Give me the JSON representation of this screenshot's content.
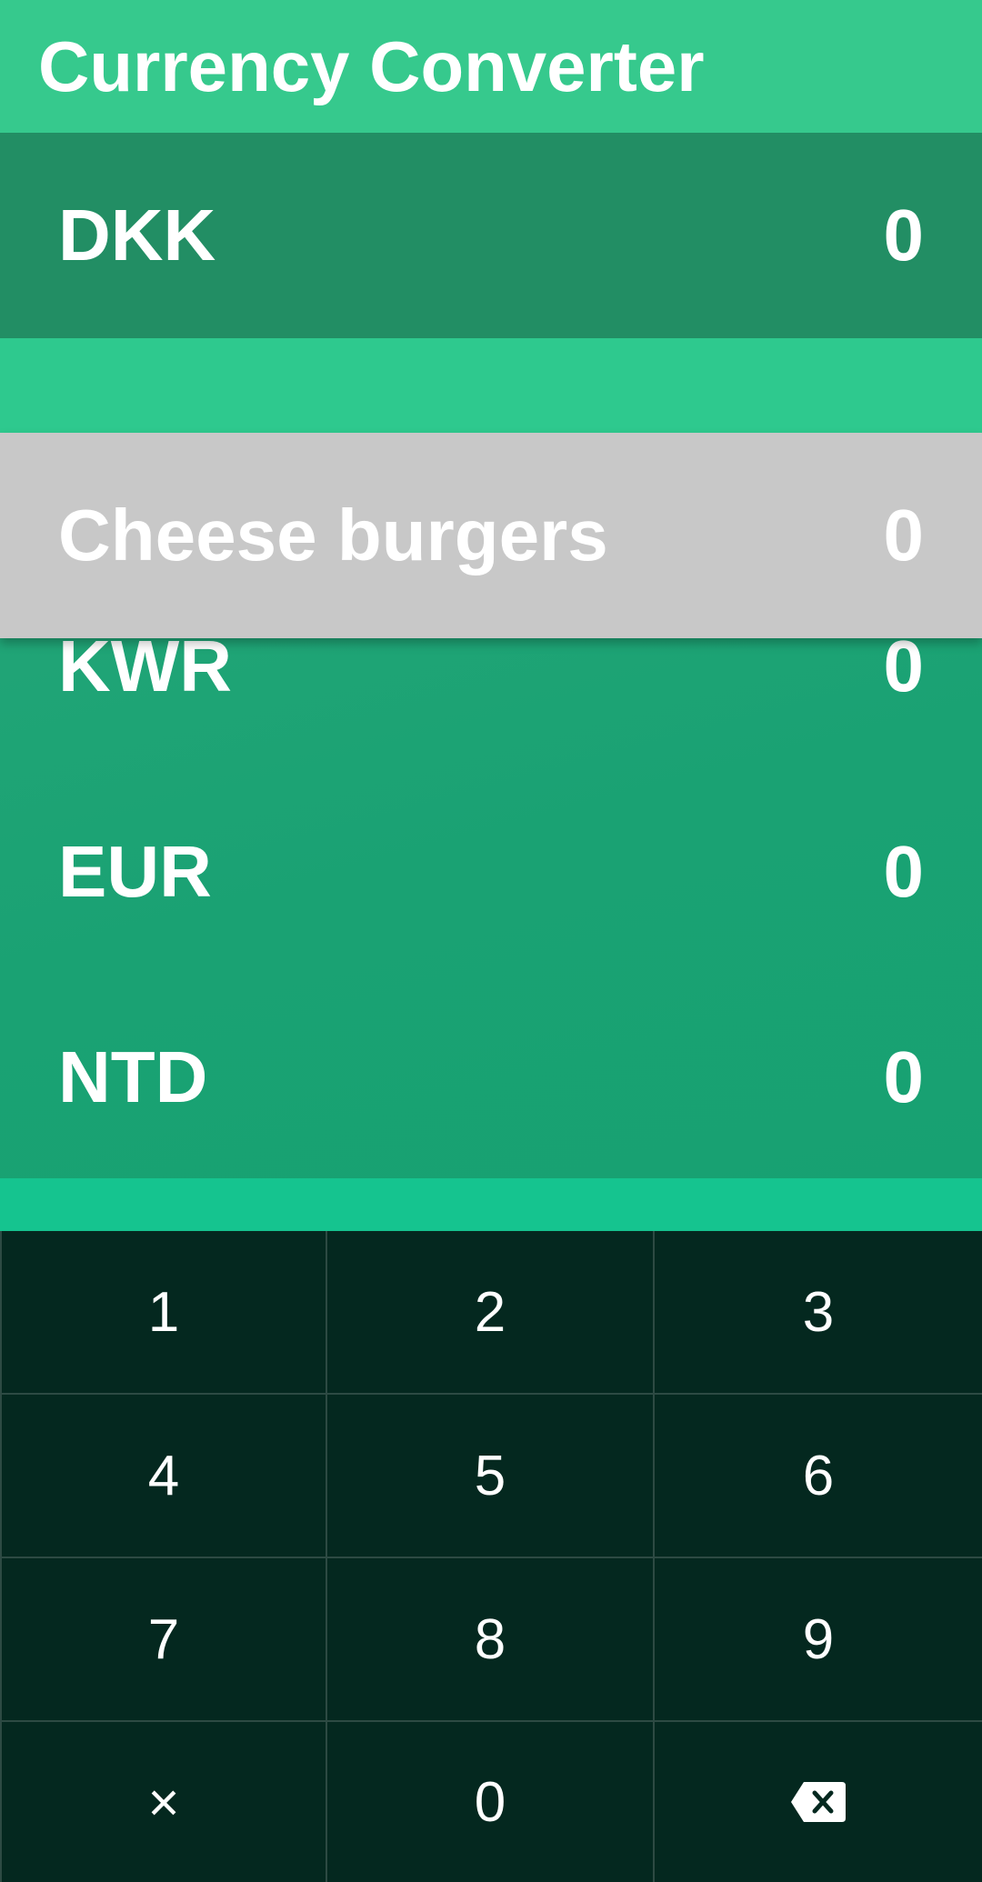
{
  "header": {
    "title": "Currency Converter"
  },
  "selected": {
    "code": "DKK",
    "value": "0"
  },
  "dragged": {
    "label": "Cheese burgers",
    "value": "0"
  },
  "list": [
    {
      "code": "KWR",
      "value": "0"
    },
    {
      "code": "EUR",
      "value": "0"
    },
    {
      "code": "NTD",
      "value": "0"
    }
  ],
  "keypad": {
    "keys": [
      "1",
      "2",
      "3",
      "4",
      "5",
      "6",
      "7",
      "8",
      "9",
      "×",
      "0"
    ],
    "clear_icon": "clear-icon",
    "backspace_icon": "backspace-icon"
  },
  "colors": {
    "header": "#36c98d",
    "selected_row": "#228e64",
    "list_bg": "#1aa273",
    "drag_row": "#c8c8c8",
    "keypad_bg": "#04281f"
  }
}
